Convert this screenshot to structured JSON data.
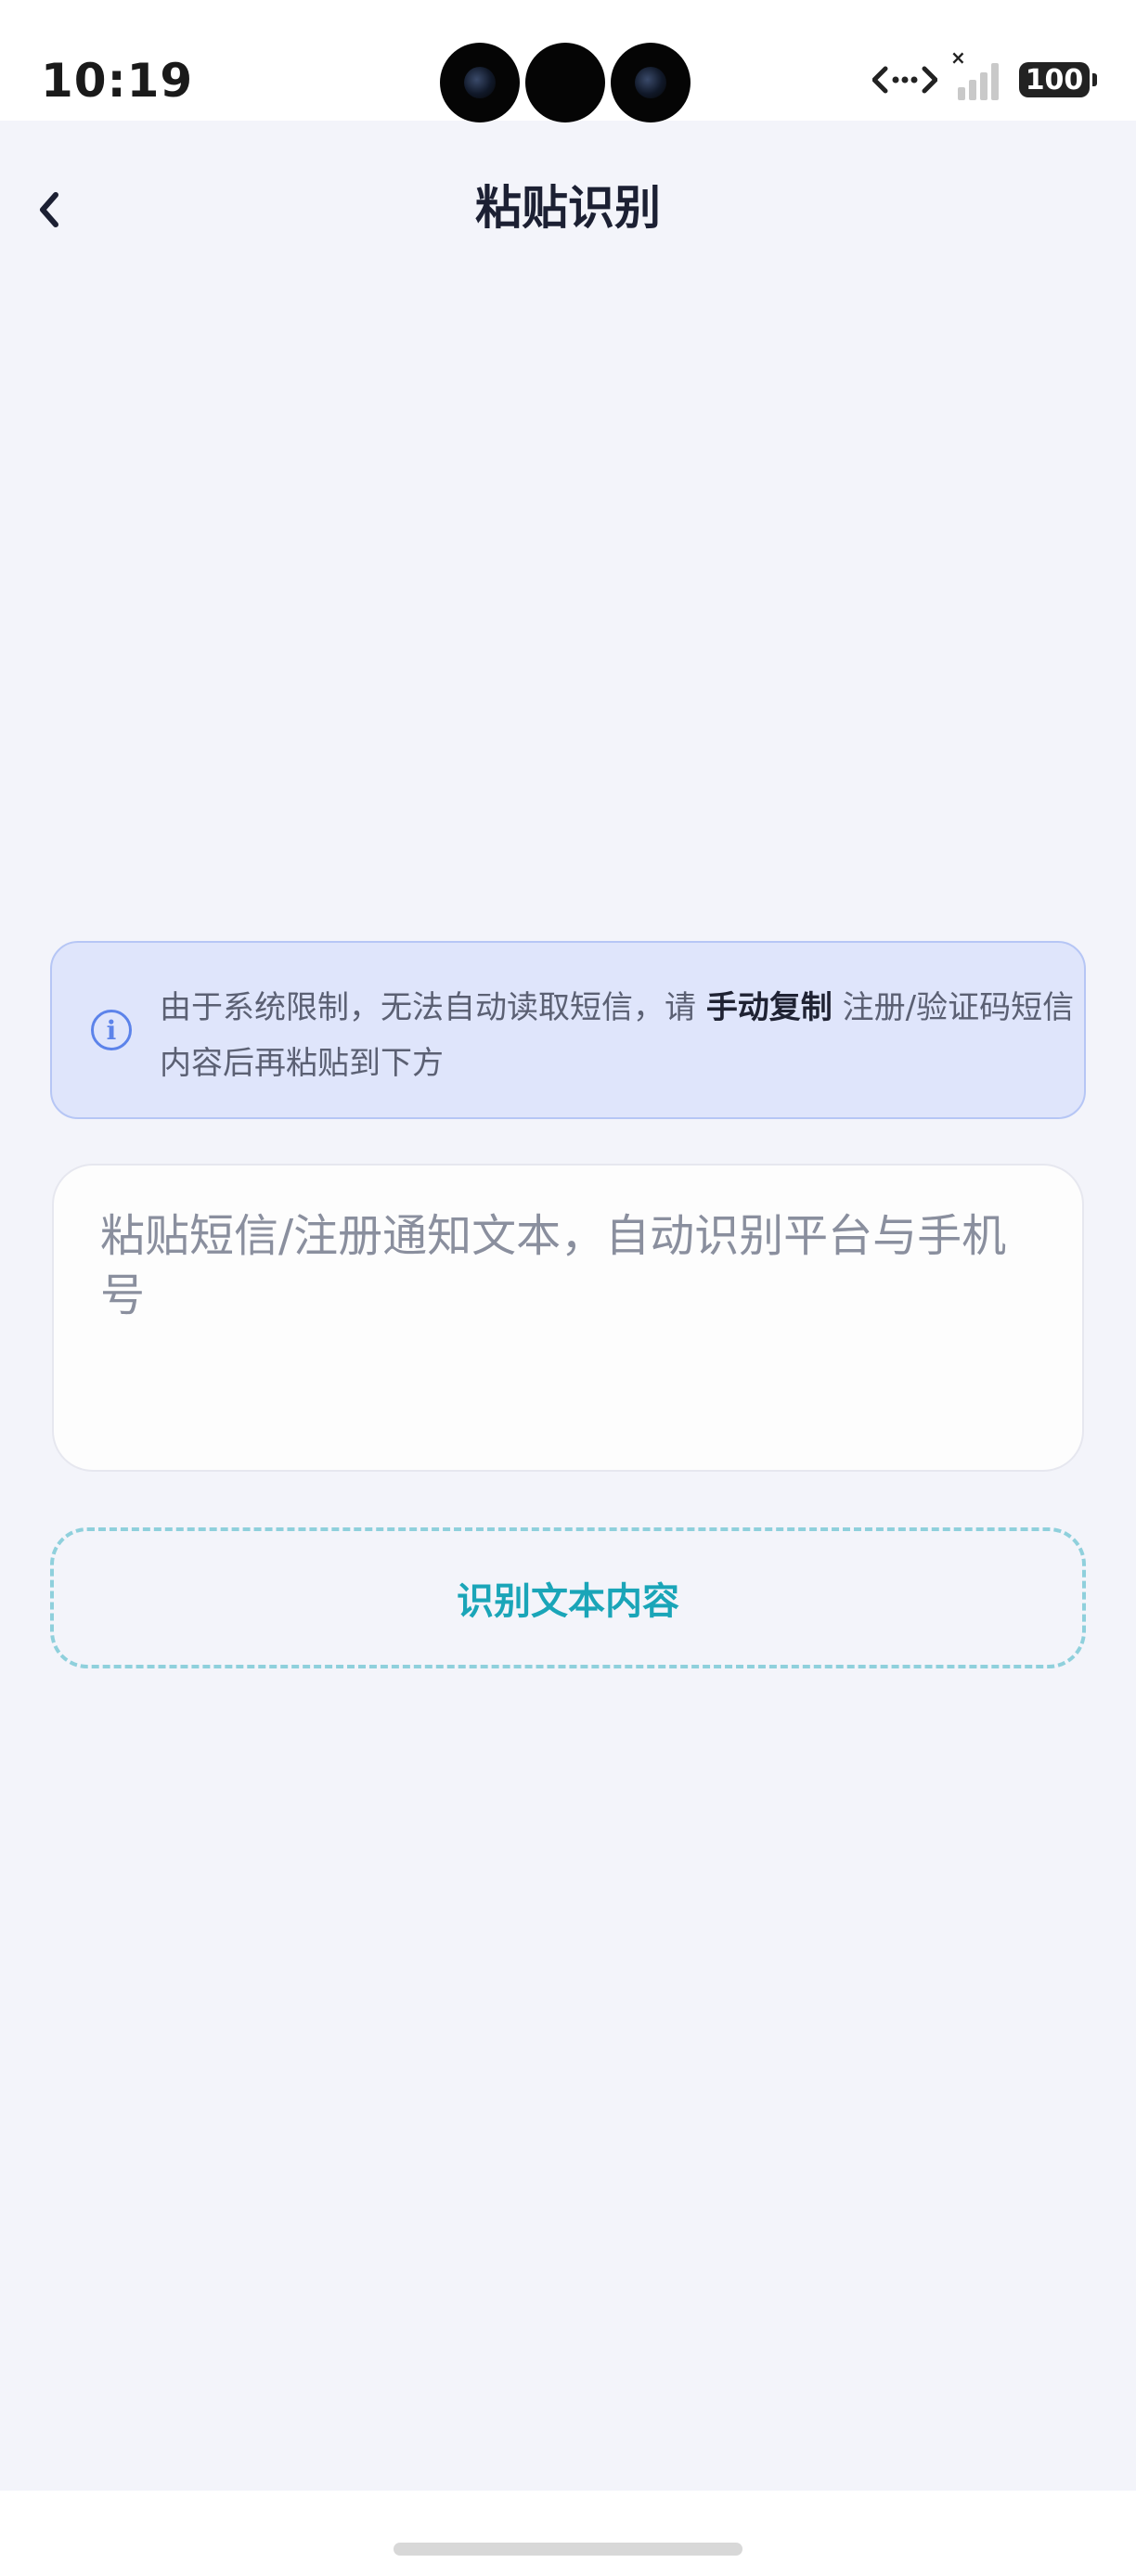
{
  "status_bar": {
    "time": "10:19",
    "battery": "100"
  },
  "nav": {
    "title": "粘贴识别"
  },
  "notice": {
    "text_before": "由于系统限制，无法自动读取短信，请 ",
    "text_bold": "手动复制",
    "text_after": " 注册/验证码短信内容后再粘贴到下方",
    "icon": "info-icon"
  },
  "input": {
    "value": "",
    "placeholder": "粘贴短信/注册通知文本，自动识别平台与手机号"
  },
  "actions": {
    "recognize_label": "识别文本内容"
  },
  "colors": {
    "background": "#f3f4fa",
    "notice_bg": "#dfe5fb",
    "accent": "#1aa5b8",
    "dashed_border": "#8fd0dc",
    "title": "#1c2033"
  }
}
